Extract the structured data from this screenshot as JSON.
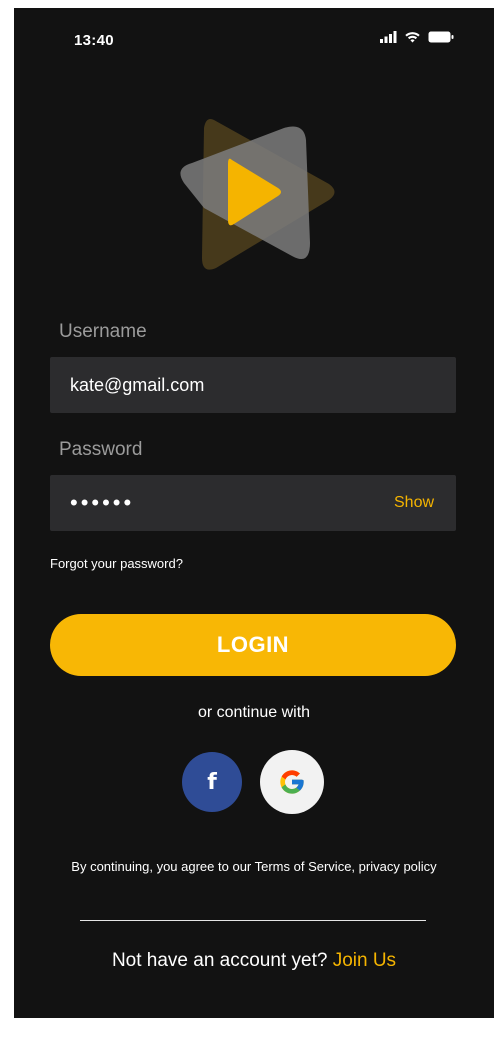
{
  "status_bar": {
    "time": "13:40",
    "icons": [
      "signal-icon",
      "wifi-icon",
      "battery-icon"
    ]
  },
  "logo": {
    "icon": "play-logo-icon",
    "colors": {
      "triangle_back": "#4a3c1c",
      "triangle_front": "#8e8e8e",
      "play": "#f5b400"
    }
  },
  "form": {
    "username_label": "Username",
    "username_value": "kate@gmail.com",
    "password_label": "Password",
    "password_value": "••••••",
    "show_label": "Show",
    "forgot_label": "Forgot your password?",
    "login_label": "LOGIN"
  },
  "social": {
    "or_text": "or continue with",
    "facebook_glyph": "f",
    "facebook_icon": "facebook-icon",
    "google_icon": "google-icon"
  },
  "footer": {
    "terms_text": "By continuing, you agree to our Terms of Service, privacy policy",
    "signup_prompt": "Not have an account yet?",
    "join_label": "Join Us"
  },
  "colors": {
    "background": "#121212",
    "accent": "#f5b400",
    "input_bg": "#2c2c2e",
    "facebook": "#2f4c96"
  }
}
